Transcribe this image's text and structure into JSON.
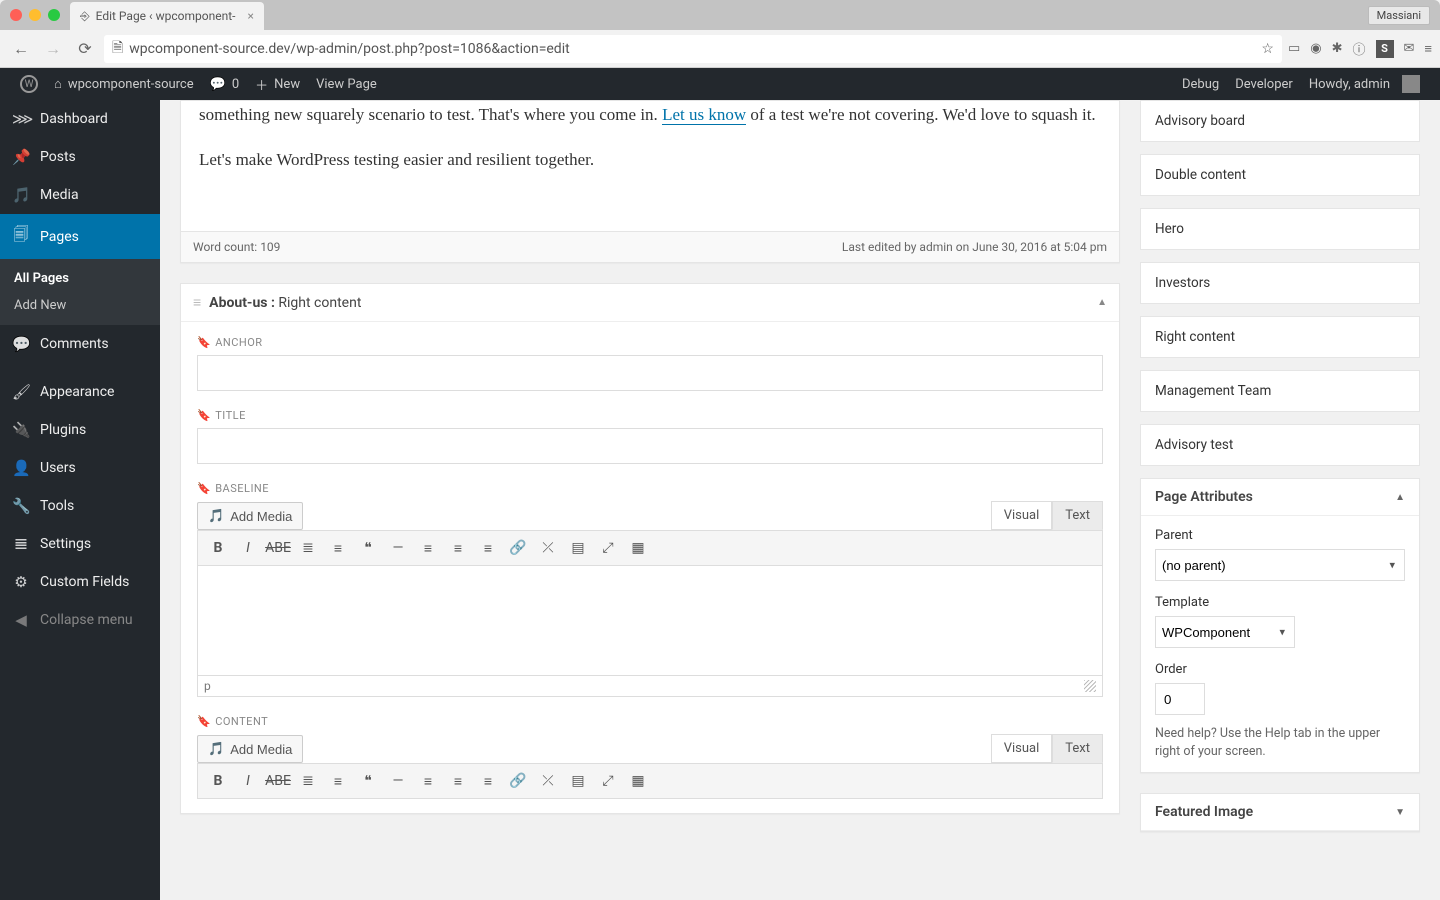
{
  "browser": {
    "tab_title": "Edit Page ‹ wpcomponent-",
    "url": "wpcomponent-source.dev/wp-admin/post.php?post=1086&action=edit",
    "user_badge": "Massiani"
  },
  "adminbar": {
    "site_name": "wpcomponent-source",
    "comments_count": "0",
    "new_label": "New",
    "view_page": "View Page",
    "debug": "Debug",
    "developer": "Developer",
    "howdy": "Howdy, admin"
  },
  "menu": {
    "dashboard": "Dashboard",
    "posts": "Posts",
    "media": "Media",
    "pages": "Pages",
    "all_pages": "All Pages",
    "add_new": "Add New",
    "comments": "Comments",
    "appearance": "Appearance",
    "plugins": "Plugins",
    "users": "Users",
    "tools": "Tools",
    "settings": "Settings",
    "custom_fields": "Custom Fields",
    "collapse": "Collapse menu"
  },
  "editor": {
    "body_line1_a": "something new squarely scenario to test. That's where you come in. ",
    "body_link": "Let us know",
    "body_line1_b": " of a test we're not covering. We'd love to squash it.",
    "body_line2": "Let's make WordPress testing easier and resilient together.",
    "word_count_label": "Word count: ",
    "word_count": "109",
    "last_edited": "Last edited by admin on June 30, 2016 at 5:04 pm"
  },
  "component": {
    "title_prefix": "About-us :",
    "title_name": " Right content",
    "field_anchor": "ANCHOR",
    "field_title": "TITLE",
    "field_baseline": "BASELINE",
    "field_content": "CONTENT",
    "add_media": "Add Media",
    "tab_visual": "Visual",
    "tab_text": "Text",
    "status_p": "p"
  },
  "side_list": {
    "items": [
      "Advisory board",
      "Double content",
      "Hero",
      "Investors",
      "Right content",
      "Management Team",
      "Advisory test"
    ]
  },
  "page_attributes": {
    "heading": "Page Attributes",
    "parent_label": "Parent",
    "parent_value": "(no parent)",
    "template_label": "Template",
    "template_value": "WPComponent",
    "order_label": "Order",
    "order_value": "0",
    "help": "Need help? Use the Help tab in the upper right of your screen."
  },
  "featured_image": {
    "heading": "Featured Image"
  }
}
